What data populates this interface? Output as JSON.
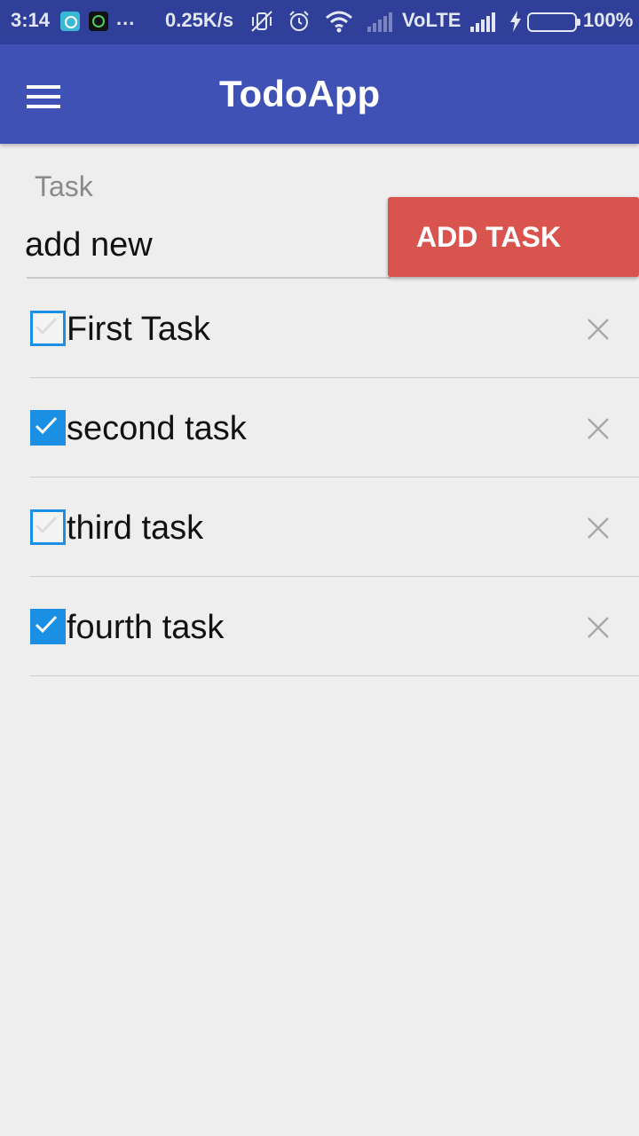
{
  "status_bar": {
    "time": "3:14",
    "dots": "...",
    "speed": "0.25K/s",
    "network": "VoLTE",
    "battery": "100%",
    "battery_level": 1.0,
    "icons": [
      "app-notification-icon",
      "whatsapp-icon",
      "vibrate-off-icon",
      "alarm-icon",
      "wifi-icon",
      "signal-icon",
      "charging-icon",
      "battery-icon"
    ]
  },
  "app_bar": {
    "title": "TodoApp",
    "menu_icon": "hamburger-menu-icon"
  },
  "input": {
    "label": "Task",
    "value": "add new",
    "button_label": "ADD TASK"
  },
  "tasks": [
    {
      "text": "First Task",
      "checked": false
    },
    {
      "text": "second task",
      "checked": true
    },
    {
      "text": "third task",
      "checked": false
    },
    {
      "text": "fourth task",
      "checked": true
    }
  ],
  "colors": {
    "status_bar": "#2f3f9a",
    "app_bar": "#3f51b5",
    "accent_button": "#d9534f",
    "checkbox": "#1a8fe3",
    "background": "#eeeeee"
  }
}
